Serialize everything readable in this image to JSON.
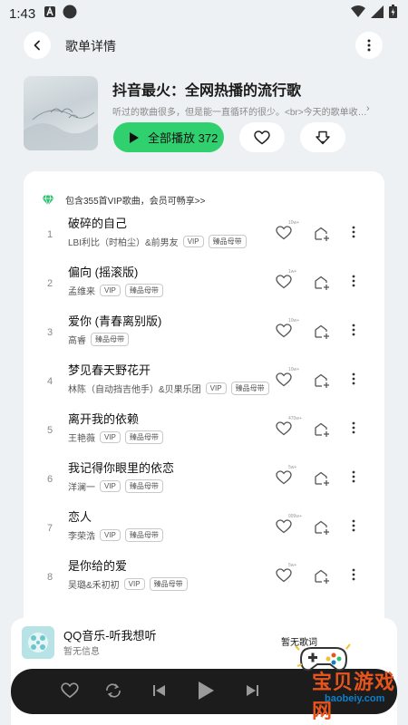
{
  "status_bar": {
    "time": "1:43"
  },
  "header": {
    "title": "歌单详情"
  },
  "playlist": {
    "title": "抖音最火：全网热播的流行歌",
    "description": "听过的歌曲很多，但是能一直循环的很少。<br>今天的歌单收…",
    "play_all_label": "全部播放 372"
  },
  "vip_notice": "包含355首VIP歌曲，会员可畅享>>",
  "songs": [
    {
      "index": "1",
      "name": "破碎的自己",
      "artist": "LBI利比（时柏尘）&前男友",
      "vip": "VIP",
      "quality": "臻品母带",
      "likes": "10w+"
    },
    {
      "index": "2",
      "name": "偏向 (摇滚版)",
      "artist": "孟维来",
      "vip": "VIP",
      "quality": "臻品母带",
      "likes": "1w+"
    },
    {
      "index": "3",
      "name": "爱你 (青春离别版)",
      "artist": "高睿",
      "vip": "",
      "quality": "臻品母带",
      "likes": "10w+"
    },
    {
      "index": "4",
      "name": "梦见春天野花开",
      "artist": "林陈（自动挡吉他手）&贝果乐团",
      "vip": "VIP",
      "quality": "臻品母带",
      "likes": "10w+"
    },
    {
      "index": "5",
      "name": "离开我的依赖",
      "artist": "王艳薇",
      "vip": "VIP",
      "quality": "臻品母带",
      "likes": "470w+"
    },
    {
      "index": "6",
      "name": "我记得你眼里的依恋",
      "artist": "洋澜一",
      "vip": "VIP",
      "quality": "臻品母带",
      "likes": "5w+"
    },
    {
      "index": "7",
      "name": "恋人",
      "artist": "李荣浩",
      "vip": "VIP",
      "quality": "臻品母带",
      "likes": "999w+"
    },
    {
      "index": "8",
      "name": "是你给的爱",
      "artist": "吴璐&禾初初",
      "vip": "VIP",
      "quality": "臻品母带",
      "likes": "5w+"
    }
  ],
  "mini_player": {
    "title": "QQ音乐-听我想听",
    "subtitle": "暂无信息",
    "lyric": "暂无歌词"
  },
  "watermark": {
    "text": "宝贝游戏网",
    "url": "baobeiy.com"
  },
  "colors": {
    "accent": "#31d06f",
    "background": "#eef1f3",
    "player_bar": "#1c1c1c"
  }
}
